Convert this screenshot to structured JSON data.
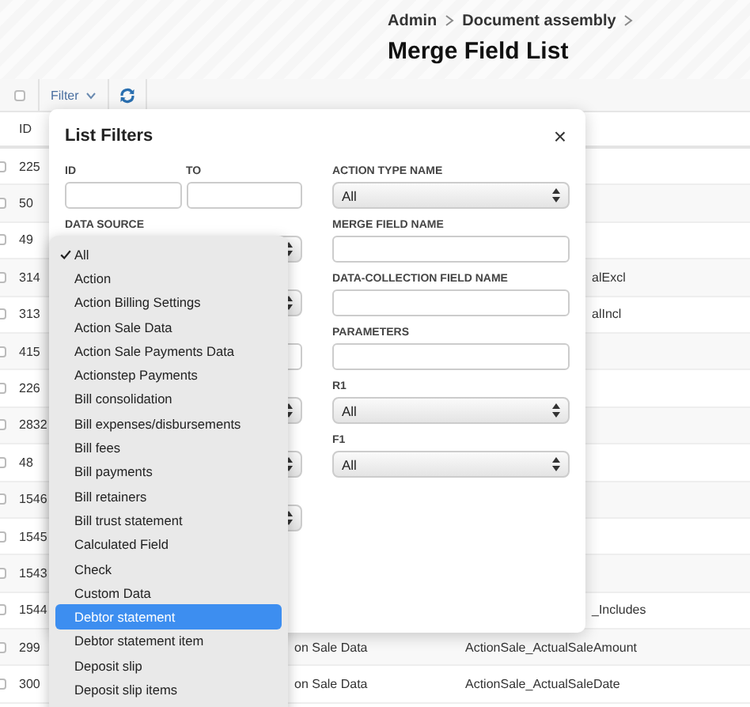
{
  "breadcrumb": [
    "Admin",
    "Document assembly"
  ],
  "title": "Merge Field List",
  "toolbar": {
    "select_all": {
      "checked": false
    },
    "filter_button": "Filter"
  },
  "table": {
    "columns": [
      "ID"
    ],
    "rows": [
      {
        "id": "225",
        "checked": false
      },
      {
        "id": "50",
        "checked": false
      },
      {
        "id": "49",
        "checked": false
      },
      {
        "id": "314",
        "checked": false,
        "column_3": "alExcl"
      },
      {
        "id": "313",
        "checked": false,
        "column_3": "alIncl"
      },
      {
        "id": "415",
        "checked": false
      },
      {
        "id": "226",
        "checked": false
      },
      {
        "id": "2832",
        "checked": false
      },
      {
        "id": "48",
        "checked": false
      },
      {
        "id": "1546",
        "checked": false
      },
      {
        "id": "1545",
        "checked": false
      },
      {
        "id": "1543",
        "checked": false
      },
      {
        "id": "1544",
        "checked": false,
        "column_3": "_Includes"
      },
      {
        "id": "299",
        "checked": false,
        "column_2": "on Sale Data",
        "column_3": "ActionSale_ActualSaleAmount"
      },
      {
        "id": "300",
        "checked": false,
        "column_2": "on Sale Data",
        "column_3": "ActionSale_ActualSaleDate"
      }
    ]
  },
  "dialog": {
    "title": "List Filters",
    "close": "×",
    "left": [
      {
        "kind": "range",
        "labels": [
          "ID",
          "TO"
        ]
      },
      {
        "kind": "select",
        "label": "DATA SOURCE"
      },
      {
        "kind": "select"
      },
      {
        "kind": "input"
      },
      {
        "kind": "select"
      },
      {
        "kind": "select"
      },
      {
        "kind": "select"
      }
    ],
    "right": [
      {
        "kind": "select",
        "label": "ACTION TYPE NAME",
        "value": "All"
      },
      {
        "kind": "input",
        "label": "MERGE FIELD NAME"
      },
      {
        "kind": "input",
        "label": "DATA-COLLECTION FIELD NAME"
      },
      {
        "kind": "input",
        "label": "PARAMETERS"
      },
      {
        "kind": "select",
        "label": "R1",
        "value": "All"
      },
      {
        "kind": "select",
        "label": "F1",
        "value": "All"
      }
    ]
  },
  "dropdown": {
    "items": [
      {
        "label": "All",
        "selected": true,
        "highlighted": false
      },
      {
        "label": "Action",
        "selected": false,
        "highlighted": false
      },
      {
        "label": "Action Billing Settings",
        "selected": false,
        "highlighted": false
      },
      {
        "label": "Action Sale Data",
        "selected": false,
        "highlighted": false
      },
      {
        "label": "Action Sale Payments Data",
        "selected": false,
        "highlighted": false
      },
      {
        "label": "Actionstep Payments",
        "selected": false,
        "highlighted": false
      },
      {
        "label": "Bill consolidation",
        "selected": false,
        "highlighted": false
      },
      {
        "label": "Bill expenses/disbursements",
        "selected": false,
        "highlighted": false
      },
      {
        "label": "Bill fees",
        "selected": false,
        "highlighted": false
      },
      {
        "label": "Bill payments",
        "selected": false,
        "highlighted": false
      },
      {
        "label": "Bill retainers",
        "selected": false,
        "highlighted": false
      },
      {
        "label": "Bill trust statement",
        "selected": false,
        "highlighted": false
      },
      {
        "label": "Calculated Field",
        "selected": false,
        "highlighted": false
      },
      {
        "label": "Check",
        "selected": false,
        "highlighted": false
      },
      {
        "label": "Custom Data",
        "selected": false,
        "highlighted": false
      },
      {
        "label": "Debtor statement",
        "selected": false,
        "highlighted": true
      },
      {
        "label": "Debtor statement item",
        "selected": false,
        "highlighted": false
      },
      {
        "label": "Deposit slip",
        "selected": false,
        "highlighted": false
      },
      {
        "label": "Deposit slip items",
        "selected": false,
        "highlighted": false
      }
    ]
  }
}
